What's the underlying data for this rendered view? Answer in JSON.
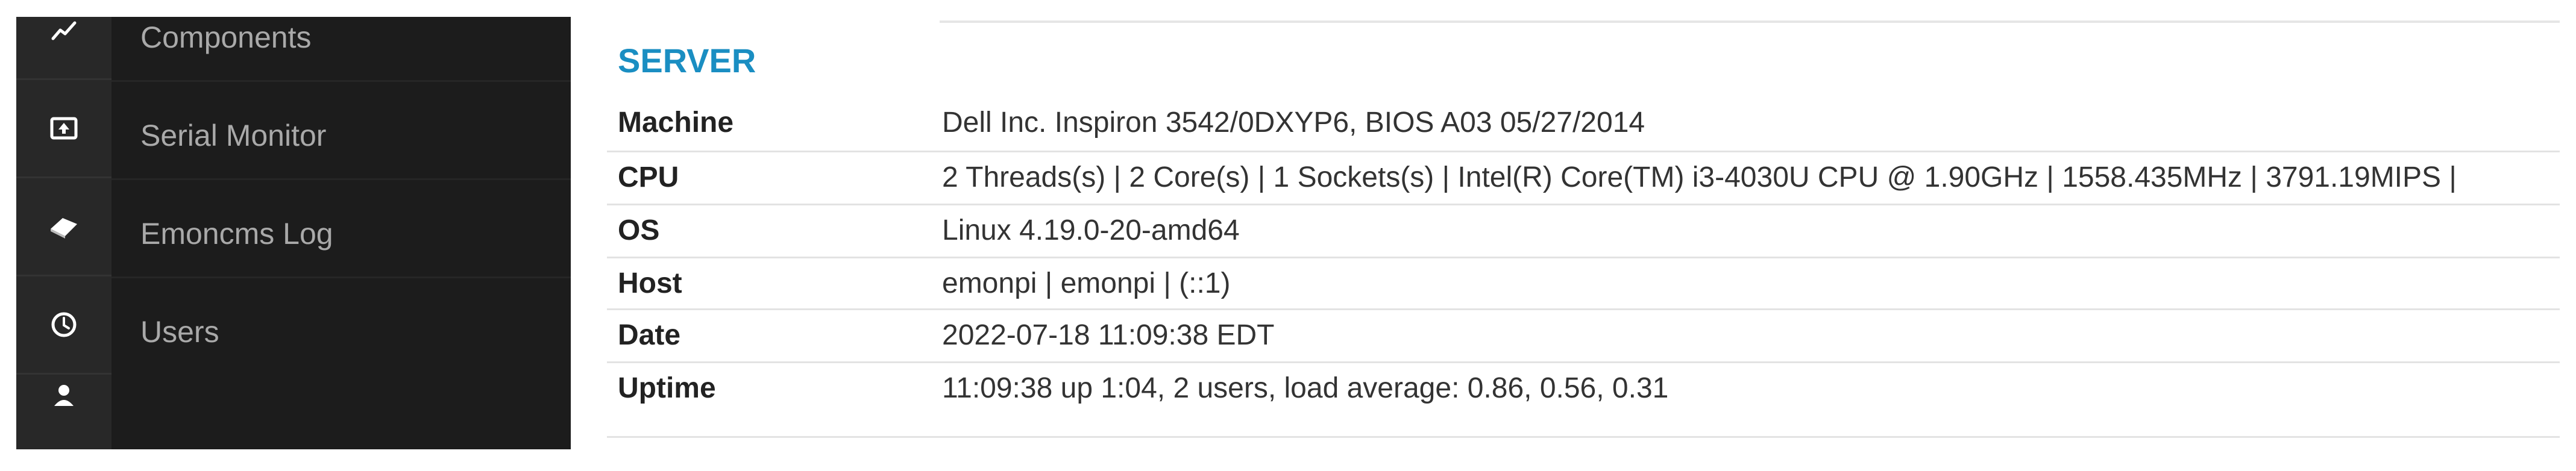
{
  "sidebar": {
    "items": [
      {
        "label": "Components"
      },
      {
        "label": "Serial Monitor"
      },
      {
        "label": "Emoncms Log"
      },
      {
        "label": "Users"
      }
    ]
  },
  "rail_icons": [
    "chart-line-icon",
    "upload-icon",
    "eraser-icon",
    "clock-icon",
    "user-icon"
  ],
  "server": {
    "title": "SERVER",
    "rows": [
      {
        "label": "Machine",
        "value": "Dell Inc. Inspiron 3542/0DXYP6, BIOS A03 05/27/2014"
      },
      {
        "label": "CPU",
        "value": "2 Threads(s) | 2 Core(s) | 1 Sockets(s) | Intel(R) Core(TM) i3-4030U CPU @ 1.90GHz | 1558.435MHz | 3791.19MIPS |"
      },
      {
        "label": "OS",
        "value": "Linux 4.19.0-20-amd64"
      },
      {
        "label": "Host",
        "value": "emonpi | emonpi | (::1)"
      },
      {
        "label": "Date",
        "value": "2022-07-18 11:09:38 EDT"
      },
      {
        "label": "Uptime",
        "value": "11:09:38 up 1:04, 2 users, load average: 0.86, 0.56, 0.31"
      }
    ]
  },
  "colors": {
    "accent": "#1a8ec2",
    "sidebar_bg": "#1c1c1c",
    "rail_bg": "#282828"
  }
}
